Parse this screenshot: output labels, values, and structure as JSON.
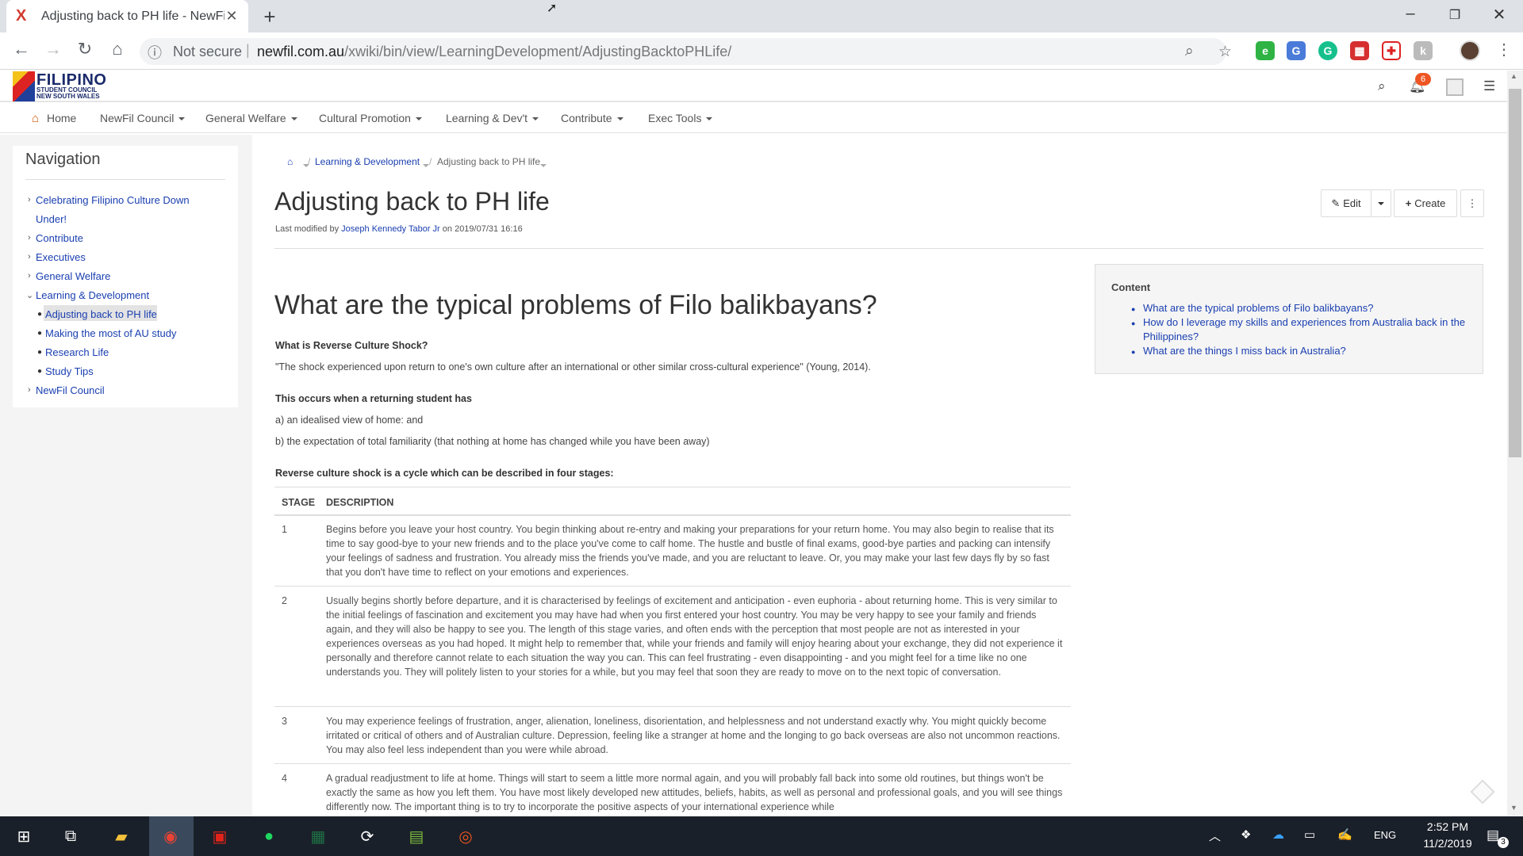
{
  "browser": {
    "tab_title": "Adjusting back to PH life - NewFi",
    "tab_favicon": "X",
    "security_label": "Not secure",
    "url_domain": "newfil.com.au",
    "url_path": "/xwiki/bin/view/LearningDevelopment/AdjustingBacktoPHLife/"
  },
  "site": {
    "logo_title": "FILIPINO",
    "logo_line2": "STUDENT COUNCIL",
    "logo_line3": "NEW SOUTH WALES",
    "notification_count": "6",
    "menu": [
      {
        "label": "Home"
      },
      {
        "label": "NewFil Council"
      },
      {
        "label": "General Welfare"
      },
      {
        "label": "Cultural Promotion"
      },
      {
        "label": "Learning & Dev't"
      },
      {
        "label": "Contribute"
      },
      {
        "label": "Exec Tools"
      }
    ]
  },
  "sidebar": {
    "title": "Navigation",
    "items": [
      {
        "label": "Celebrating Filipino Culture Down"
      },
      {
        "label": "Under!"
      },
      {
        "label": "Contribute"
      },
      {
        "label": "Executives"
      },
      {
        "label": "General Welfare"
      },
      {
        "label": "Learning & Development"
      },
      {
        "label": "Adjusting back to PH life"
      },
      {
        "label": "Making the most of AU study"
      },
      {
        "label": "Research Life"
      },
      {
        "label": "Study Tips"
      },
      {
        "label": "NewFil Council"
      }
    ]
  },
  "breadcrumb": {
    "sep": "/",
    "parent": "Learning & Development",
    "current": "Adjusting back to PH life"
  },
  "page": {
    "title": "Adjusting back to PH life",
    "modified_prefix": "Last modified by",
    "modified_author": "Joseph Kennedy Tabor Jr",
    "modified_suffix": "on 2019/07/31 16:16",
    "edit_label": "Edit",
    "create_label": "Create"
  },
  "content": {
    "heading": "What are the typical problems of Filo balikbayans?",
    "q1": "What is Reverse Culture Shock?",
    "quote": "\"The shock experienced upon return to one's own culture after an international or other similar cross-cultural experience\" (Young, 2014).",
    "occurs": "This occurs when a returning student has",
    "a": "a) an idealised view of home: and",
    "b": "b) the expectation of total familiarity (that nothing at home has changed while you have been away)",
    "cycle": "Reverse culture shock is a cycle which can be described in four stages:",
    "table_headers": [
      "STAGE",
      "DESCRIPTION"
    ],
    "rows": [
      {
        "stage": "1",
        "desc": "Begins before you leave your host country. You begin thinking about re-entry and making your preparations for your return home. You may also begin to realise that its time to say good-bye to your new friends and to the place you've come to calf home. The hustle and bustle of final exams, good-bye parties and packing can intensify your feelings of sadness and frustration. You already miss the friends you've made, and you are reluctant to leave. Or, you may make your last few days fly by so fast that you don't have time to reflect on your emotions and experiences."
      },
      {
        "stage": "2",
        "desc": "Usually begins shortly before departure, and it is characterised by feelings of excitement and anticipation - even euphoria - about returning home. This is very similar to the initial feelings of fascination and excitement you may have had when you first entered your host country. You may be very happy to see your family and friends again, and they will also be happy to see you. The length of this stage varies, and often ends with the perception that most people are not as interested in your experiences overseas as you had hoped. It might help to remember that, while your friends and family will enjoy hearing about your exchange, they did not experience it personally and therefore cannot relate to each situation the way you can. This can feel frustrating - even disappointing - and you might feel for a time like no one understands you. They will politely listen to your stories for a while, but you may feel that soon they are ready to move on to the next topic of conversation."
      },
      {
        "stage": "3",
        "desc": "You may experience feelings of frustration, anger, alienation, loneliness, disorientation, and helplessness and not understand exactly why. You might quickly become irritated or critical of others and of Australian culture. Depression, feeling like a stranger at home and the longing to go back overseas are also not uncommon reactions. You may also feel less independent than you were while abroad."
      },
      {
        "stage": "4",
        "desc": "A gradual readjustment to life at home. Things will start to seem a little more normal again, and you will probably fall back into some old routines, but things won't be exactly the same as how you left them. You have most likely developed new attitudes, beliefs, habits, as well as personal and professional goals, and you will see things differently now. The important thing is to try to incorporate the positive aspects of your international experience while"
      }
    ]
  },
  "toc": {
    "title": "Content",
    "items": [
      "What are the typical problems of Filo balikbayans?",
      "How do I leverage my skills and experiences from Australia back in the Philippines?",
      "What are the things I miss back in Australia?"
    ]
  },
  "taskbar": {
    "lang": "ENG",
    "time": "2:52 PM",
    "date": "11/2/2019",
    "notif_count": "3"
  }
}
